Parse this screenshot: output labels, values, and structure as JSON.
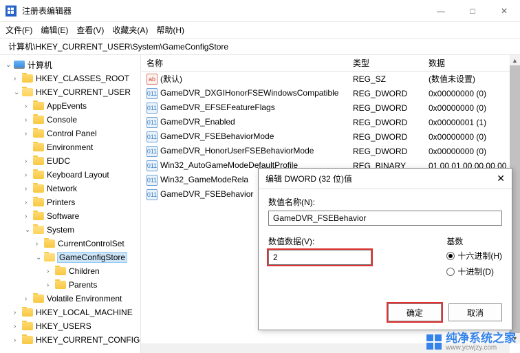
{
  "window": {
    "title": "注册表编辑器",
    "minimize": "—",
    "maximize": "□",
    "close": "✕"
  },
  "menubar": {
    "file": "文件(F)",
    "edit": "编辑(E)",
    "view": "查看(V)",
    "favorites": "收藏夹(A)",
    "help": "帮助(H)"
  },
  "address": "计算机\\HKEY_CURRENT_USER\\System\\GameConfigStore",
  "tree": {
    "root": "计算机",
    "items": [
      {
        "label": "HKEY_CLASSES_ROOT",
        "chevron": "›",
        "depth": 1
      },
      {
        "label": "HKEY_CURRENT_USER",
        "chevron": "⌄",
        "depth": 1,
        "open": true
      },
      {
        "label": "AppEvents",
        "chevron": "›",
        "depth": 2
      },
      {
        "label": "Console",
        "chevron": "›",
        "depth": 2
      },
      {
        "label": "Control Panel",
        "chevron": "›",
        "depth": 2
      },
      {
        "label": "Environment",
        "chevron": "",
        "depth": 2
      },
      {
        "label": "EUDC",
        "chevron": "›",
        "depth": 2
      },
      {
        "label": "Keyboard Layout",
        "chevron": "›",
        "depth": 2
      },
      {
        "label": "Network",
        "chevron": "›",
        "depth": 2
      },
      {
        "label": "Printers",
        "chevron": "›",
        "depth": 2
      },
      {
        "label": "Software",
        "chevron": "›",
        "depth": 2
      },
      {
        "label": "System",
        "chevron": "⌄",
        "depth": 2,
        "open": true
      },
      {
        "label": "CurrentControlSet",
        "chevron": "›",
        "depth": 3
      },
      {
        "label": "GameConfigStore",
        "chevron": "⌄",
        "depth": 3,
        "open": true,
        "selected": true
      },
      {
        "label": "Children",
        "chevron": "›",
        "depth": 4
      },
      {
        "label": "Parents",
        "chevron": "›",
        "depth": 4
      },
      {
        "label": "Volatile Environment",
        "chevron": "›",
        "depth": 2
      },
      {
        "label": "HKEY_LOCAL_MACHINE",
        "chevron": "›",
        "depth": 1
      },
      {
        "label": "HKEY_USERS",
        "chevron": "›",
        "depth": 1
      },
      {
        "label": "HKEY_CURRENT_CONFIG",
        "chevron": "›",
        "depth": 1
      }
    ]
  },
  "list": {
    "headers": {
      "name": "名称",
      "type": "类型",
      "data": "数据"
    },
    "rows": [
      {
        "name": "(默认)",
        "type": "REG_SZ",
        "data": "(数值未设置)",
        "iconKind": "sz",
        "iconText": "ab"
      },
      {
        "name": "GameDVR_DXGIHonorFSEWindowsCompatible",
        "type": "REG_DWORD",
        "data": "0x00000000 (0)",
        "iconKind": "dw",
        "iconText": "011"
      },
      {
        "name": "GameDVR_EFSEFeatureFlags",
        "type": "REG_DWORD",
        "data": "0x00000000 (0)",
        "iconKind": "dw",
        "iconText": "011"
      },
      {
        "name": "GameDVR_Enabled",
        "type": "REG_DWORD",
        "data": "0x00000001 (1)",
        "iconKind": "dw",
        "iconText": "011"
      },
      {
        "name": "GameDVR_FSEBehaviorMode",
        "type": "REG_DWORD",
        "data": "0x00000000 (0)",
        "iconKind": "dw",
        "iconText": "011"
      },
      {
        "name": "GameDVR_HonorUserFSEBehaviorMode",
        "type": "REG_DWORD",
        "data": "0x00000000 (0)",
        "iconKind": "dw",
        "iconText": "011"
      },
      {
        "name": "Win32_AutoGameModeDefaultProfile",
        "type": "REG_BINARY",
        "data": "01 00 01 00 00 00 00",
        "iconKind": "dw",
        "iconText": "011"
      },
      {
        "name": "Win32_GameModeRela",
        "type": "",
        "data": "",
        "iconKind": "dw",
        "iconText": "011"
      },
      {
        "name": "GameDVR_FSEBehavior",
        "type": "",
        "data": "",
        "iconKind": "dw",
        "iconText": "011"
      }
    ]
  },
  "dialog": {
    "title": "编辑 DWORD (32 位)值",
    "name_label": "数值名称(N):",
    "name_value": "GameDVR_FSEBehavior",
    "data_label": "数值数据(V):",
    "data_value": "2",
    "base_label": "基数",
    "radio_hex": "十六进制(H)",
    "radio_dec": "十进制(D)",
    "ok": "确定",
    "cancel": "取消"
  },
  "watermark": {
    "brand": "纯净系统之家",
    "url": "www.ycwjzy.com"
  }
}
